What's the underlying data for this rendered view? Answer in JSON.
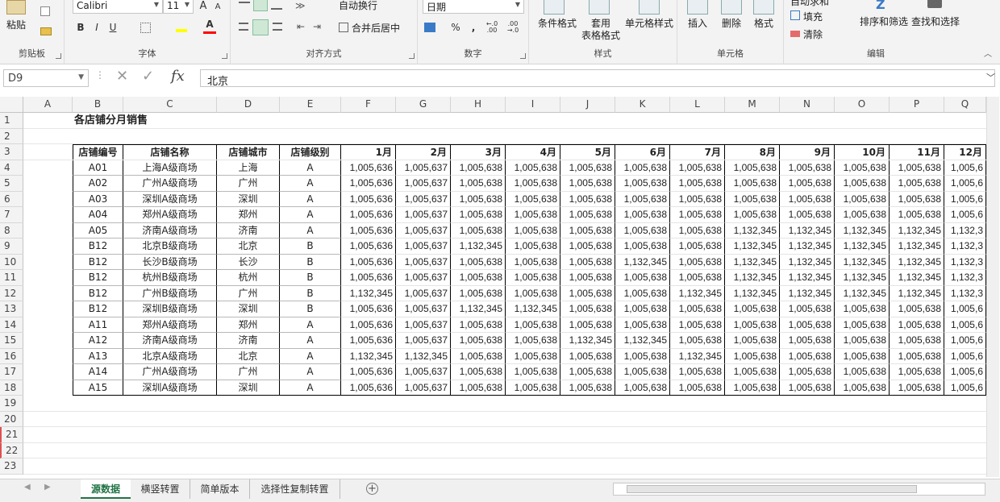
{
  "ribbon": {
    "clipboard": {
      "paste_label": "粘贴",
      "group_label": "剪贴板"
    },
    "font": {
      "name": "Calibri",
      "size": "11",
      "grow": "A",
      "shrink": "A",
      "bold": "B",
      "italic": "I",
      "underline": "U",
      "fill_color": "#ffff00",
      "font_color_letter": "A",
      "font_color": "#ff0000",
      "group_label": "字体"
    },
    "alignment": {
      "wrap_text": "自动换行",
      "merge_center": "合并后居中",
      "group_label": "对齐方式"
    },
    "number": {
      "format": "日期",
      "percent": "%",
      "comma": ",",
      "inc_decimal": "←.0 .00",
      "dec_decimal": ".00 →.0",
      "group_label": "数字"
    },
    "styles": {
      "cond_format": "条件格式",
      "table_format_1": "套用",
      "table_format_2": "表格格式",
      "cell_styles": "单元格样式",
      "group_label": "样式"
    },
    "cells": {
      "insert": "插入",
      "delete": "删除",
      "format": "格式",
      "group_label": "单元格"
    },
    "editing": {
      "autosum": "自动求和",
      "fill": "填充",
      "clear": "清除",
      "sort_filter": "排序和筛选",
      "find_select": "查找和选择",
      "group_label": "编辑"
    }
  },
  "formula_bar": {
    "name_box": "D9",
    "fx": "fx",
    "value": "北京"
  },
  "columns": [
    "A",
    "B",
    "C",
    "D",
    "E",
    "F",
    "G",
    "H",
    "I",
    "J",
    "K",
    "L",
    "M",
    "N",
    "O",
    "P",
    "Q"
  ],
  "rows": [
    "1",
    "2",
    "3",
    "4",
    "5",
    "6",
    "7",
    "8",
    "9",
    "10",
    "11",
    "12",
    "13",
    "14",
    "15",
    "16",
    "17",
    "18",
    "19",
    "20",
    "21",
    "22",
    "23"
  ],
  "sheet": {
    "title": "各店铺分月销售",
    "headers": [
      "店铺编号",
      "店铺名称",
      "店铺城市",
      "店铺级别",
      "1月",
      "2月",
      "3月",
      "4月",
      "5月",
      "6月",
      "7月",
      "8月",
      "9月",
      "10月",
      "11月",
      "12月"
    ],
    "data": [
      [
        "A01",
        "上海A级商场",
        "上海",
        "A",
        "1,005,636",
        "1,005,637",
        "1,005,638",
        "1,005,638",
        "1,005,638",
        "1,005,638",
        "1,005,638",
        "1,005,638",
        "1,005,638",
        "1,005,638",
        "1,005,638",
        "1,005,6"
      ],
      [
        "A02",
        "广州A级商场",
        "广州",
        "A",
        "1,005,636",
        "1,005,637",
        "1,005,638",
        "1,005,638",
        "1,005,638",
        "1,005,638",
        "1,005,638",
        "1,005,638",
        "1,005,638",
        "1,005,638",
        "1,005,638",
        "1,005,6"
      ],
      [
        "A03",
        "深圳A级商场",
        "深圳",
        "A",
        "1,005,636",
        "1,005,637",
        "1,005,638",
        "1,005,638",
        "1,005,638",
        "1,005,638",
        "1,005,638",
        "1,005,638",
        "1,005,638",
        "1,005,638",
        "1,005,638",
        "1,005,6"
      ],
      [
        "A04",
        "郑州A级商场",
        "郑州",
        "A",
        "1,005,636",
        "1,005,637",
        "1,005,638",
        "1,005,638",
        "1,005,638",
        "1,005,638",
        "1,005,638",
        "1,005,638",
        "1,005,638",
        "1,005,638",
        "1,005,638",
        "1,005,6"
      ],
      [
        "A05",
        "济南A级商场",
        "济南",
        "A",
        "1,005,636",
        "1,005,637",
        "1,005,638",
        "1,005,638",
        "1,005,638",
        "1,005,638",
        "1,005,638",
        "1,132,345",
        "1,132,345",
        "1,132,345",
        "1,132,345",
        "1,132,3"
      ],
      [
        "B12",
        "北京B级商场",
        "北京",
        "B",
        "1,005,636",
        "1,005,637",
        "1,132,345",
        "1,005,638",
        "1,005,638",
        "1,005,638",
        "1,005,638",
        "1,132,345",
        "1,132,345",
        "1,132,345",
        "1,132,345",
        "1,132,3"
      ],
      [
        "B12",
        "长沙B级商场",
        "长沙",
        "B",
        "1,005,636",
        "1,005,637",
        "1,005,638",
        "1,005,638",
        "1,005,638",
        "1,132,345",
        "1,005,638",
        "1,132,345",
        "1,132,345",
        "1,132,345",
        "1,132,345",
        "1,132,3"
      ],
      [
        "B12",
        "杭州B级商场",
        "杭州",
        "B",
        "1,005,636",
        "1,005,637",
        "1,005,638",
        "1,005,638",
        "1,005,638",
        "1,005,638",
        "1,005,638",
        "1,132,345",
        "1,132,345",
        "1,132,345",
        "1,132,345",
        "1,132,3"
      ],
      [
        "B12",
        "广州B级商场",
        "广州",
        "B",
        "1,132,345",
        "1,005,637",
        "1,005,638",
        "1,005,638",
        "1,005,638",
        "1,005,638",
        "1,132,345",
        "1,132,345",
        "1,132,345",
        "1,132,345",
        "1,132,345",
        "1,132,3"
      ],
      [
        "B12",
        "深圳B级商场",
        "深圳",
        "B",
        "1,005,636",
        "1,005,637",
        "1,132,345",
        "1,132,345",
        "1,005,638",
        "1,005,638",
        "1,005,638",
        "1,005,638",
        "1,005,638",
        "1,005,638",
        "1,005,638",
        "1,005,6"
      ],
      [
        "A11",
        "郑州A级商场",
        "郑州",
        "A",
        "1,005,636",
        "1,005,637",
        "1,005,638",
        "1,005,638",
        "1,005,638",
        "1,005,638",
        "1,005,638",
        "1,005,638",
        "1,005,638",
        "1,005,638",
        "1,005,638",
        "1,005,6"
      ],
      [
        "A12",
        "济南A级商场",
        "济南",
        "A",
        "1,005,636",
        "1,005,637",
        "1,005,638",
        "1,005,638",
        "1,132,345",
        "1,132,345",
        "1,005,638",
        "1,005,638",
        "1,005,638",
        "1,005,638",
        "1,005,638",
        "1,005,6"
      ],
      [
        "A13",
        "北京A级商场",
        "北京",
        "A",
        "1,132,345",
        "1,132,345",
        "1,005,638",
        "1,005,638",
        "1,005,638",
        "1,005,638",
        "1,132,345",
        "1,005,638",
        "1,005,638",
        "1,005,638",
        "1,005,638",
        "1,005,6"
      ],
      [
        "A14",
        "广州A级商场",
        "广州",
        "A",
        "1,005,636",
        "1,005,637",
        "1,005,638",
        "1,005,638",
        "1,005,638",
        "1,005,638",
        "1,005,638",
        "1,005,638",
        "1,005,638",
        "1,005,638",
        "1,005,638",
        "1,005,6"
      ],
      [
        "A15",
        "深圳A级商场",
        "深圳",
        "A",
        "1,005,636",
        "1,005,637",
        "1,005,638",
        "1,005,638",
        "1,005,638",
        "1,005,638",
        "1,005,638",
        "1,005,638",
        "1,005,638",
        "1,005,638",
        "1,005,638",
        "1,005,6"
      ]
    ]
  },
  "tabs": [
    "源数据",
    "横竖转置",
    "简单版本",
    "选择性复制转置"
  ],
  "active_tab": "源数据",
  "add_sheet_icon": "plus-circle-icon",
  "accent_color": "#217346"
}
